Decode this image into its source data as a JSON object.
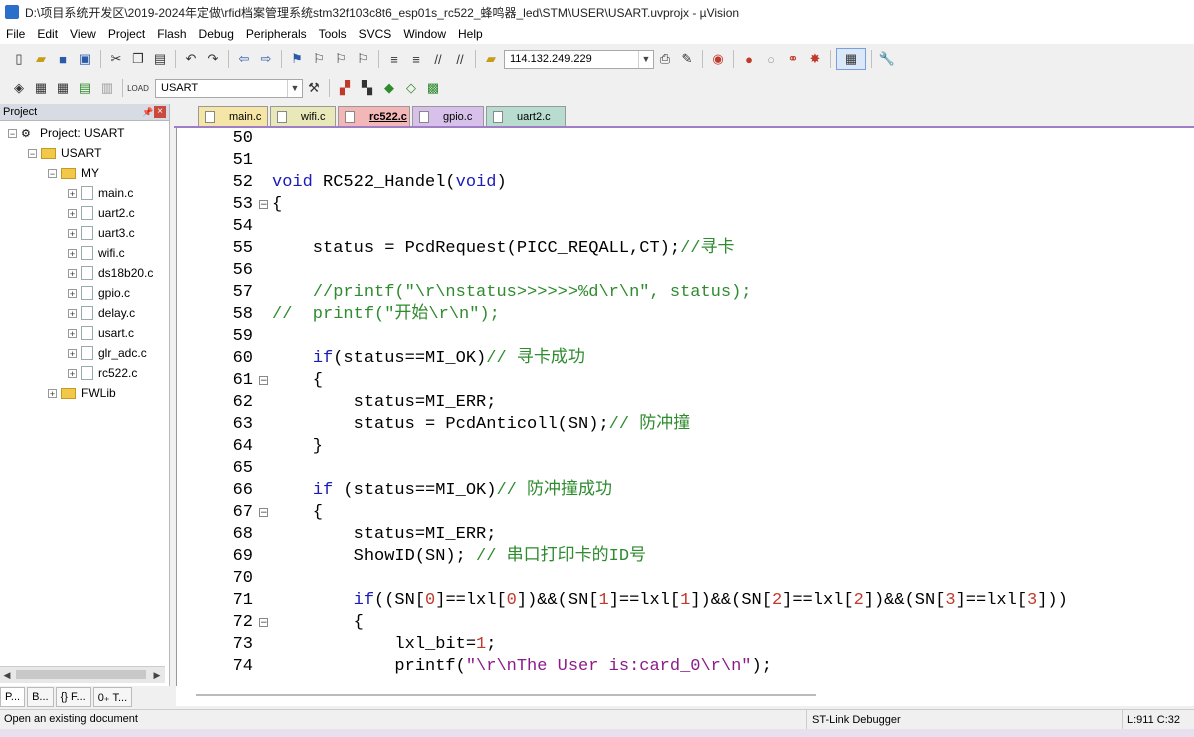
{
  "window": {
    "title": "D:\\项目系统开发区\\2019-2024年定做\\rfid档案管理系统stm32f103c8t6_esp01s_rc522_蜂鸣器_led\\STM\\USER\\USART.uvprojx - µVision"
  },
  "menu": [
    "File",
    "Edit",
    "View",
    "Project",
    "Flash",
    "Debug",
    "Peripherals",
    "Tools",
    "SVCS",
    "Window",
    "Help"
  ],
  "toolbar": {
    "ip_value": "114.132.249.229",
    "target_value": "USART"
  },
  "project_panel": {
    "title": "Project",
    "root": "Project: USART",
    "target": "USART",
    "group_my": "MY",
    "files": [
      "main.c",
      "uart2.c",
      "uart3.c",
      "wifi.c",
      "ds18b20.c",
      "gpio.c",
      "delay.c",
      "usart.c",
      "glr_adc.c",
      "rc522.c"
    ],
    "group_fwlib": "FWLib",
    "bottom_tabs": [
      "P...",
      "B...",
      "{} F...",
      "0₊ T..."
    ]
  },
  "editor_tabs": [
    {
      "label": "main.c",
      "color": "#f5e6a8",
      "active": false
    },
    {
      "label": "wifi.c",
      "color": "#e8e8b8",
      "active": false
    },
    {
      "label": "rc522.c",
      "color": "#f3b7b7",
      "active": true
    },
    {
      "label": "gpio.c",
      "color": "#d7c1ea",
      "active": false
    },
    {
      "label": "uart2.c",
      "color": "#b8dcd0",
      "active": false
    }
  ],
  "code": [
    {
      "n": "50",
      "t": ""
    },
    {
      "n": "51",
      "t": ""
    },
    {
      "n": "52",
      "t": "void RC522_Handel(void)"
    },
    {
      "n": "53",
      "t": "{"
    },
    {
      "n": "54",
      "t": ""
    },
    {
      "n": "55",
      "t": "    status = PcdRequest(PICC_REQALL,CT);//寻卡"
    },
    {
      "n": "56",
      "t": ""
    },
    {
      "n": "57",
      "t": "    //printf(\"\\r\\nstatus>>>>>>%d\\r\\n\", status);"
    },
    {
      "n": "58",
      "t": "//  printf(\"开始\\r\\n\");"
    },
    {
      "n": "59",
      "t": ""
    },
    {
      "n": "60",
      "t": "    if(status==MI_OK)// 寻卡成功"
    },
    {
      "n": "61",
      "t": "    {"
    },
    {
      "n": "62",
      "t": "        status=MI_ERR;"
    },
    {
      "n": "63",
      "t": "        status = PcdAnticoll(SN);// 防冲撞"
    },
    {
      "n": "64",
      "t": "    }"
    },
    {
      "n": "65",
      "t": ""
    },
    {
      "n": "66",
      "t": "    if (status==MI_OK)// 防冲撞成功"
    },
    {
      "n": "67",
      "t": "    {"
    },
    {
      "n": "68",
      "t": "        status=MI_ERR;"
    },
    {
      "n": "69",
      "t": "        ShowID(SN); // 串口打印卡的ID号"
    },
    {
      "n": "70",
      "t": ""
    },
    {
      "n": "71",
      "t": "        if((SN[0]==lxl[0])&&(SN[1]==lxl[1])&&(SN[2]==lxl[2])&&(SN[3]==lxl[3]))"
    },
    {
      "n": "72",
      "t": "        {"
    },
    {
      "n": "73",
      "t": "            lxl_bit=1;"
    },
    {
      "n": "74",
      "t": "            printf(\"\\r\\nThe User is:card_0\\r\\n\");"
    }
  ],
  "status": {
    "left": "Open an existing document",
    "debugger": "ST-Link Debugger",
    "pos": "L:911 C:32"
  }
}
